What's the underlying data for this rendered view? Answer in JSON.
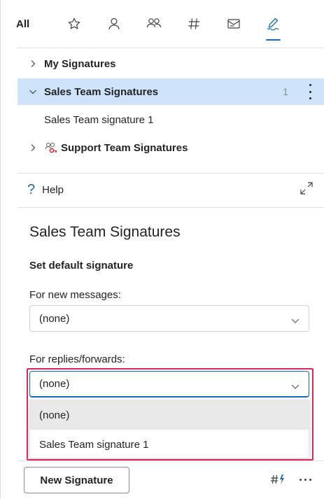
{
  "tabs": {
    "all_label": "All",
    "icons": [
      "star-icon",
      "person-icon",
      "people-icon",
      "hashtag-icon",
      "mail-template-icon",
      "signature-icon"
    ],
    "active": "signature-icon",
    "accent_color": "#0f6cbd"
  },
  "tree": {
    "my_signatures": "My Signatures",
    "sales_team": "Sales Team Signatures",
    "sales_team_count": "1",
    "sales_team_child": "Sales Team signature 1",
    "support_team": "Support Team Signatures"
  },
  "help": {
    "label": "Help"
  },
  "details": {
    "title": "Sales Team Signatures",
    "subtitle": "Set default signature",
    "new_messages_label": "For new messages:",
    "new_messages_value": "(none)",
    "replies_label": "For replies/forwards:",
    "replies_value": "(none)",
    "replies_options": [
      "(none)",
      "Sales Team signature 1"
    ]
  },
  "footer": {
    "new_signature_label": "New Signature"
  },
  "colors": {
    "selected_row": "#cfe4fa",
    "highlight_border": "#e0245e"
  }
}
